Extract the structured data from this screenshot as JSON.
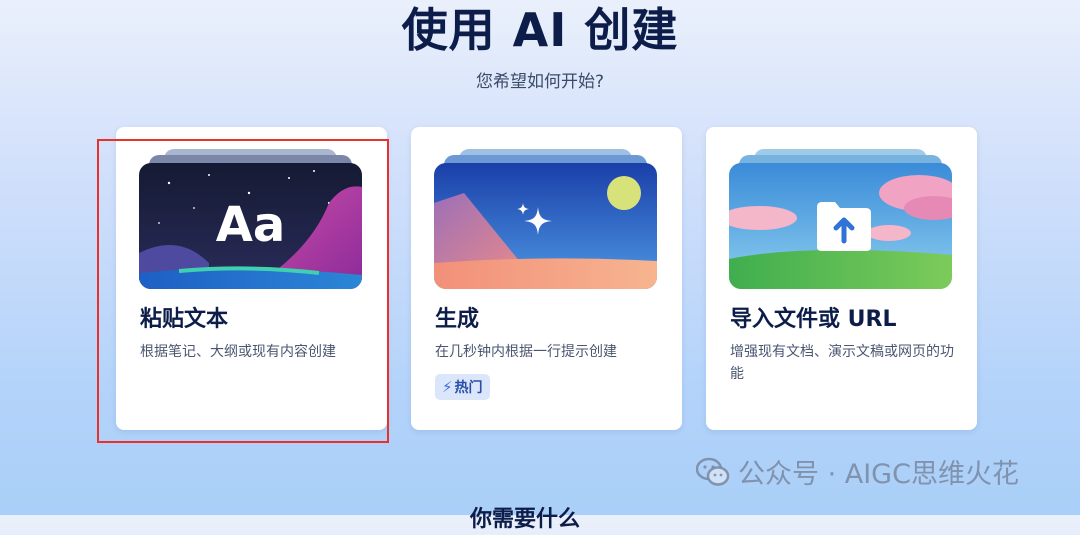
{
  "header": {
    "title": "使用 AI 创建",
    "subtitle": "您希望如何开始?"
  },
  "cards": [
    {
      "title": "粘贴文本",
      "description": "根据笔记、大纲或现有内容创建",
      "art_label": "Aa",
      "highlighted": true
    },
    {
      "title": "生成",
      "description": "在几秒钟内根据一行提示创建",
      "badge": "热门"
    },
    {
      "title": "导入文件或 URL",
      "description": "增强现有文档、演示文稿或网页的功能"
    }
  ],
  "watermark": {
    "text": "公众号 · AIGC思维火花"
  },
  "footer": {
    "partial_text": "你需要什么"
  },
  "colors": {
    "highlight_border": "#e8302c",
    "title": "#0d1d4a",
    "badge_bg": "#dbe6fb",
    "badge_text": "#2a4fa8"
  },
  "icons": [
    "sparkle-icon",
    "upload-folder-icon",
    "lightning-icon",
    "wechat-icon"
  ]
}
